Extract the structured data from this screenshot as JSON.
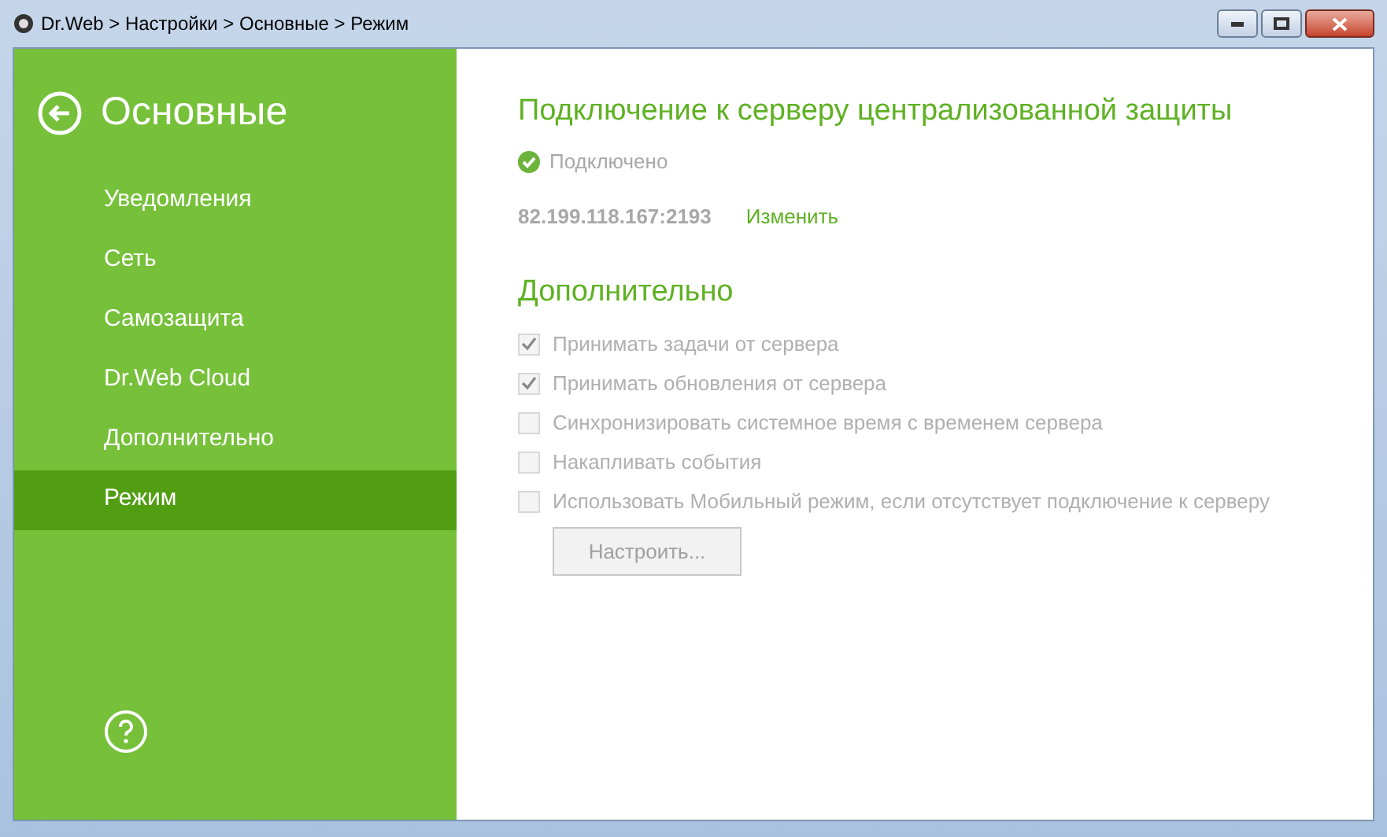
{
  "window": {
    "title": "Dr.Web > Настройки > Основные > Режим"
  },
  "sidebar": {
    "title": "Основные",
    "items": [
      {
        "label": "Уведомления",
        "selected": false
      },
      {
        "label": "Сеть",
        "selected": false
      },
      {
        "label": "Самозащита",
        "selected": false
      },
      {
        "label": "Dr.Web Cloud",
        "selected": false
      },
      {
        "label": "Дополнительно",
        "selected": false
      },
      {
        "label": "Режим",
        "selected": true
      }
    ]
  },
  "connection": {
    "heading": "Подключение к серверу централизованной защиты",
    "status": "Подключено",
    "address": "82.199.118.167:2193",
    "change_link": "Изменить"
  },
  "additional": {
    "heading": "Дополнительно",
    "options": [
      {
        "label": "Принимать задачи от сервера",
        "checked": true,
        "disabled": true
      },
      {
        "label": "Принимать обновления от сервера",
        "checked": true,
        "disabled": true
      },
      {
        "label": "Синхронизировать системное время с временем сервера",
        "checked": false,
        "disabled": true
      },
      {
        "label": "Накапливать события",
        "checked": false,
        "disabled": true
      },
      {
        "label": "Использовать Мобильный режим, если отсутствует подключение к серверу",
        "checked": false,
        "disabled": true
      }
    ],
    "configure_button": {
      "label": "Настроить...",
      "disabled": true
    }
  }
}
